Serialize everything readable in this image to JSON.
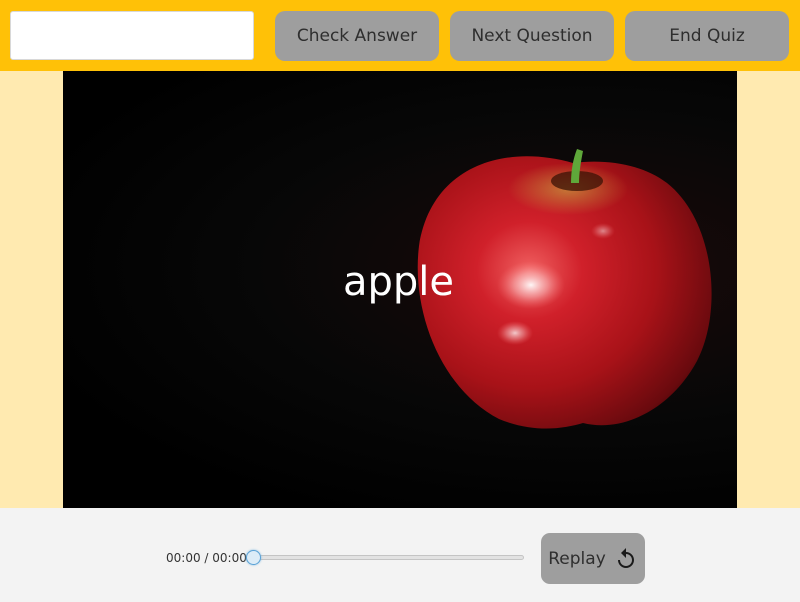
{
  "toolbar": {
    "answer_placeholder": "",
    "answer_value": "",
    "check_label": "Check Answer",
    "next_label": "Next Question",
    "end_label": "End Quiz"
  },
  "stage": {
    "word": "apple",
    "image_subject": "red apple on black background"
  },
  "player": {
    "time": "00:00 / 00:00",
    "progress": 0,
    "replay_label": "Replay",
    "replay_icon": "replay-icon"
  },
  "colors": {
    "topbar": "#ffc107",
    "page_background": "#ffeab0",
    "button": "#9e9e9e",
    "controls_bar": "#f3f3f3"
  }
}
